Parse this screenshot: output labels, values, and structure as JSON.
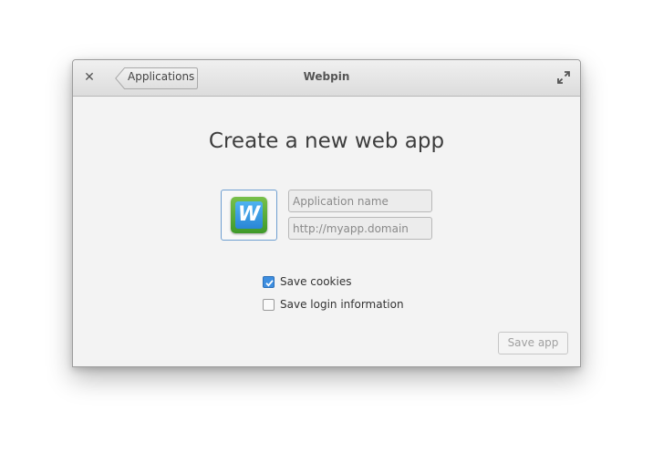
{
  "window": {
    "title": "Webpin",
    "back_label": "Applications"
  },
  "icons": {
    "close": "close-icon",
    "back": "chevron-left-icon",
    "maximize": "maximize-icon",
    "app": "webpin-app-icon"
  },
  "app_icon_letter": "W",
  "main": {
    "heading": "Create a new web app",
    "name_placeholder": "Application name",
    "name_value": "",
    "url_placeholder": "http://myapp.domain",
    "url_value": "",
    "save_cookies_label": "Save cookies",
    "save_cookies_checked": true,
    "save_login_label": "Save login information",
    "save_login_checked": false,
    "save_button_label": "Save app",
    "save_button_enabled": false
  },
  "colors": {
    "accent": "#3d8ee0",
    "focus_border": "#6f9fd1"
  }
}
